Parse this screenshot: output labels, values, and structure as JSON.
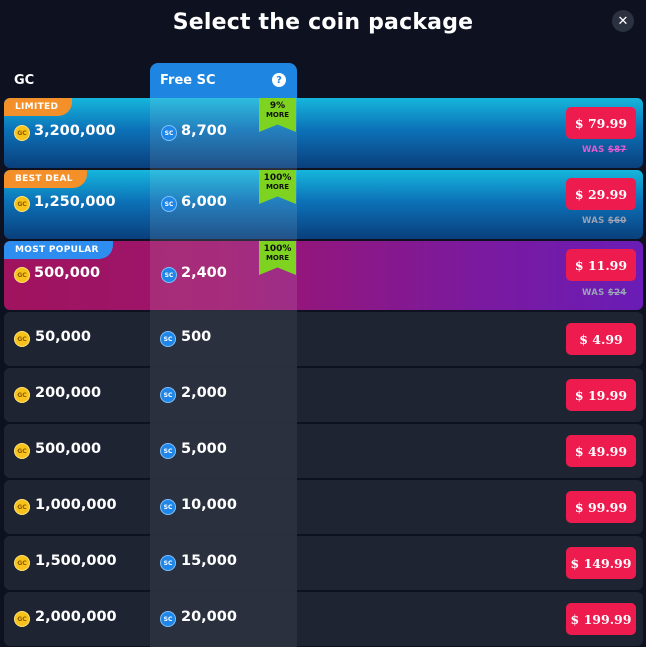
{
  "title": "Select the coin package",
  "close_icon_glyph": "✕",
  "columns": {
    "gc_header": "GC",
    "sc_header": "Free SC",
    "help_glyph": "?"
  },
  "coin_labels": {
    "gc": "GC",
    "sc": "SC"
  },
  "featured": [
    {
      "tag": "LIMITED",
      "gc": "3,200,000",
      "sc": "8,700",
      "ribbon_pct": "9%",
      "ribbon_more": "MORE",
      "price": "$ 79.99",
      "was_label": "WAS",
      "was_price": "$87"
    },
    {
      "tag": "BEST DEAL",
      "gc": "1,250,000",
      "sc": "6,000",
      "ribbon_pct": "100%",
      "ribbon_more": "MORE",
      "price": "$ 29.99",
      "was_label": "WAS",
      "was_price": "$60"
    },
    {
      "tag": "MOST POPULAR",
      "gc": "500,000",
      "sc": "2,400",
      "ribbon_pct": "100%",
      "ribbon_more": "MORE",
      "price": "$ 11.99",
      "was_label": "WAS",
      "was_price": "$24"
    }
  ],
  "packages": [
    {
      "gc": "50,000",
      "sc": "500",
      "price": "$ 4.99"
    },
    {
      "gc": "200,000",
      "sc": "2,000",
      "price": "$ 19.99"
    },
    {
      "gc": "500,000",
      "sc": "5,000",
      "price": "$ 49.99"
    },
    {
      "gc": "1,000,000",
      "sc": "10,000",
      "price": "$ 99.99"
    },
    {
      "gc": "1,500,000",
      "sc": "15,000",
      "price": "$ 149.99"
    },
    {
      "gc": "2,000,000",
      "sc": "20,000",
      "price": "$ 199.99"
    }
  ],
  "colors": {
    "background": "#0d1120",
    "price_button": "#ee1b4f",
    "sc_header": "#1e86e0",
    "ribbon": "#7ed321",
    "tag_orange": "#f4902a",
    "tag_blue": "#2e8ef0"
  }
}
